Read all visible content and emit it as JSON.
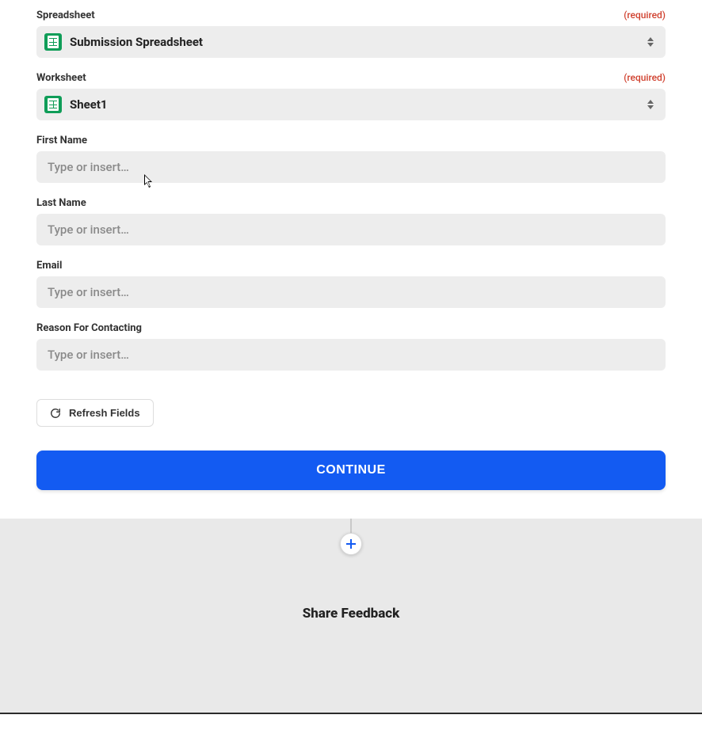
{
  "colors": {
    "primary": "#135bf2",
    "required": "#d0402e",
    "sheets": "#0f9d58"
  },
  "fields": {
    "spreadsheet": {
      "label": "Spreadsheet",
      "required_text": "(required)",
      "value": "Submission Spreadsheet",
      "icon": "google-sheets-icon"
    },
    "worksheet": {
      "label": "Worksheet",
      "required_text": "(required)",
      "value": "Sheet1",
      "icon": "google-sheets-icon"
    },
    "first_name": {
      "label": "First Name",
      "placeholder": "Type or insert…",
      "value": ""
    },
    "last_name": {
      "label": "Last Name",
      "placeholder": "Type or insert…",
      "value": ""
    },
    "email": {
      "label": "Email",
      "placeholder": "Type or insert…",
      "value": ""
    },
    "reason": {
      "label": "Reason For Contacting",
      "placeholder": "Type or insert…",
      "value": ""
    }
  },
  "buttons": {
    "refresh": "Refresh Fields",
    "continue": "CONTINUE"
  },
  "footer": {
    "share_feedback": "Share Feedback"
  }
}
